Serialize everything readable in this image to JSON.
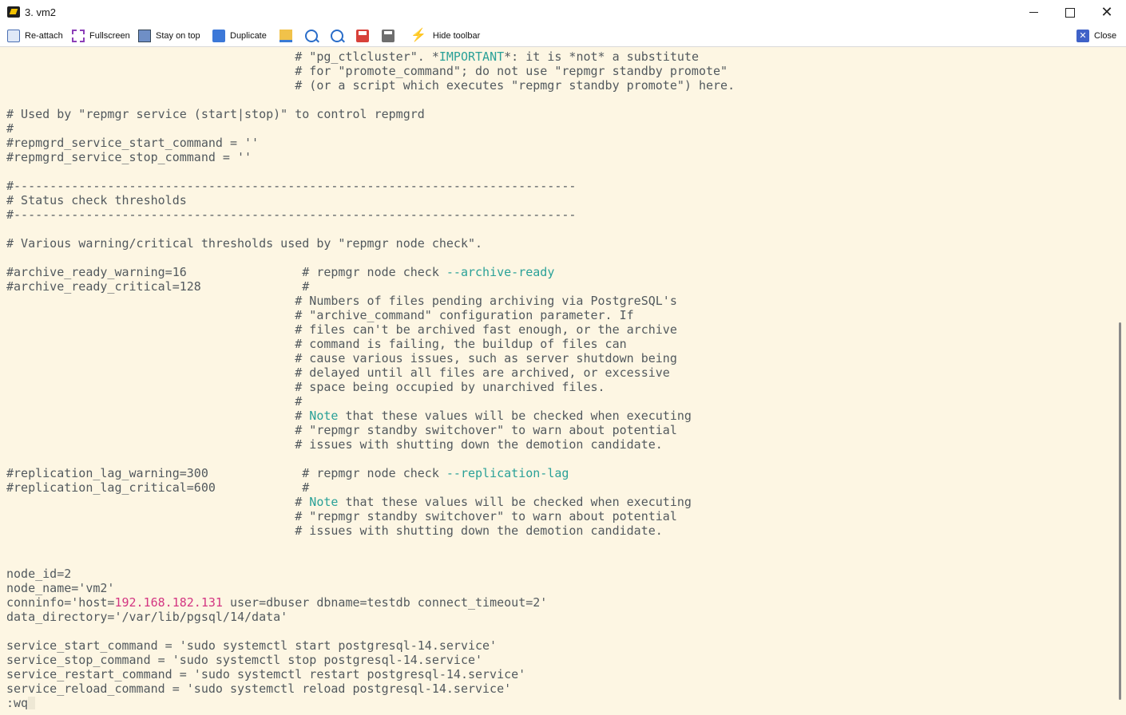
{
  "window": {
    "title": "3. vm2",
    "minimize_glyph": "—",
    "maximize_glyph": "☐",
    "close_glyph": "✕"
  },
  "toolbar": {
    "reattach": "Re-attach",
    "fullscreen": "Fullscreen",
    "stay_on_top": "Stay on top",
    "duplicate": "Duplicate",
    "hide_toolbar": "Hide toolbar",
    "close": "Close",
    "icons": [
      "reattach-icon",
      "fullscreen-icon",
      "stay-on-top-icon",
      "duplicate-icon",
      "edit-icon",
      "zoom-in-icon",
      "zoom-out-icon",
      "save-icon",
      "print-icon",
      "hide-toolbar-icon",
      "close-icon"
    ]
  },
  "colors": {
    "terminal_bg": "#fdf6e3",
    "text": "#52595e",
    "keyword": "#2aa198",
    "ip": "#d33682"
  },
  "terminal": {
    "lines": [
      "                                        # \"pg_ctlcluster\". *IMPORTANT*: it is *not* a substitute",
      "                                        # for \"promote_command\"; do not use \"repmgr standby promote\"",
      "                                        # (or a script which executes \"repmgr standby promote\") here.",
      "",
      "# Used by \"repmgr service (start|stop)\" to control repmgrd",
      "#",
      "#repmgrd_service_start_command = ''",
      "#repmgrd_service_stop_command = ''",
      "",
      "#------------------------------------------------------------------------------",
      "# Status check thresholds",
      "#------------------------------------------------------------------------------",
      "",
      "# Various warning/critical thresholds used by \"repmgr node check\".",
      "",
      "#archive_ready_warning=16                # repmgr node check --archive-ready",
      "#archive_ready_critical=128              #",
      "                                        # Numbers of files pending archiving via PostgreSQL's",
      "                                        # \"archive_command\" configuration parameter. If",
      "                                        # files can't be archived fast enough, or the archive",
      "                                        # command is failing, the buildup of files can",
      "                                        # cause various issues, such as server shutdown being",
      "                                        # delayed until all files are archived, or excessive",
      "                                        # space being occupied by unarchived files.",
      "                                        #",
      "                                        # Note that these values will be checked when executing",
      "                                        # \"repmgr standby switchover\" to warn about potential",
      "                                        # issues with shutting down the demotion candidate.",
      "",
      "#replication_lag_warning=300             # repmgr node check --replication-lag",
      "#replication_lag_critical=600            #",
      "                                        # Note that these values will be checked when executing",
      "                                        # \"repmgr standby switchover\" to warn about potential",
      "                                        # issues with shutting down the demotion candidate.",
      "",
      "",
      "node_id=2",
      "node_name='vm2'",
      "conninfo='host=192.168.182.131 user=dbuser dbname=testdb connect_timeout=2'",
      "data_directory='/var/lib/pgsql/14/data'",
      "",
      "service_start_command = 'sudo systemctl start postgresql-14.service'",
      "service_stop_command = 'sudo systemctl stop postgresql-14.service'",
      "service_restart_command = 'sudo systemctl restart postgresql-14.service'",
      "service_reload_command = 'sudo systemctl reload postgresql-14.service'",
      ":wq"
    ],
    "highlight_cyan": [
      "IMPORTANT",
      "--archive-ready",
      "--replication-lag",
      "Note"
    ],
    "highlight_magenta": [
      "192.168.182.131"
    ]
  }
}
